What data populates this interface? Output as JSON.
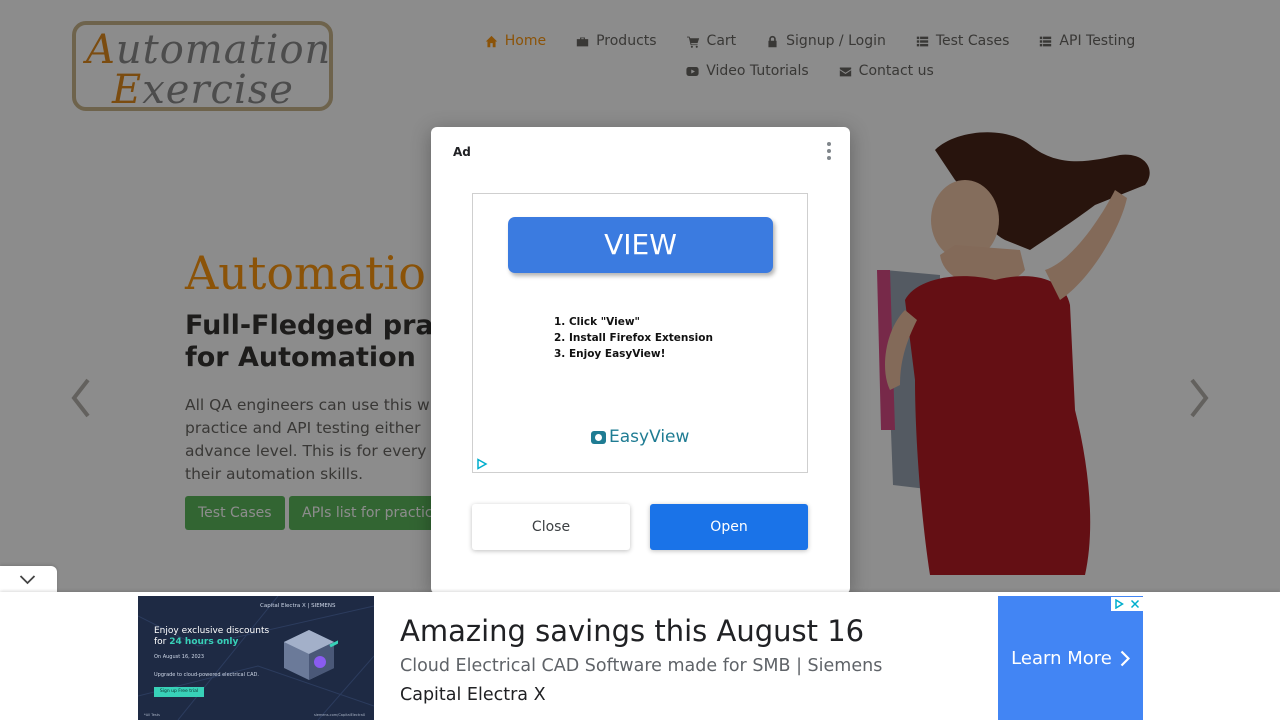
{
  "logo": {
    "line1_cap": "A",
    "line1_rest": "utomation",
    "line2_cap": "E",
    "line2_rest": "xercise"
  },
  "nav": {
    "row1": [
      {
        "label": "Home",
        "icon": "home-icon",
        "active": true
      },
      {
        "label": "Products",
        "icon": "briefcase-icon"
      },
      {
        "label": "Cart",
        "icon": "cart-icon"
      },
      {
        "label": "Signup / Login",
        "icon": "lock-icon"
      },
      {
        "label": "Test Cases",
        "icon": "list-icon"
      },
      {
        "label": "API Testing",
        "icon": "list-icon"
      }
    ],
    "row2": [
      {
        "label": "Video Tutorials",
        "icon": "youtube-icon"
      },
      {
        "label": "Contact us",
        "icon": "envelope-icon"
      }
    ]
  },
  "hero": {
    "title": "Automatio",
    "subtitle_line1": "Full-Fledged pra",
    "subtitle_line2": "for Automation",
    "desc_line1": "All QA engineers can use this w",
    "desc_line2": "practice and API testing either",
    "desc_line3": "advance level. This is for every",
    "desc_line4": "their automation skills.",
    "btn_test_cases": "Test Cases",
    "btn_api": "APIs list for practic"
  },
  "ad_dialog": {
    "label": "Ad",
    "view_button": "VIEW",
    "step1": "1. Click \"View\"",
    "step2": "2. Install Firefox Extension",
    "step3": "3. Enjoy EasyView!",
    "brand": "EasyView",
    "close_label": "Close",
    "open_label": "Open"
  },
  "anchor_ad": {
    "image": {
      "brand": "Capital Electra X | SIEMENS",
      "line1": "Enjoy exclusive discounts",
      "line2_pre": "for ",
      "line2_highlight": "24 hours only",
      "date": "On August 16, 2023",
      "upgrade": "Upgrade to cloud-powered electrical CAD.",
      "cta": "Sign up Free trial",
      "footer_left": "*All Tests",
      "footer_right": "siemens.com/CapitalElectraX"
    },
    "title": "Amazing savings this August 16",
    "subtitle": "Cloud Electrical CAD Software made for SMB | Siemens",
    "advertiser": "Capital Electra X",
    "cta_label": "Learn More"
  },
  "colors": {
    "accent": "#fe980f",
    "green": "#5cb85c",
    "open_blue": "#1a73e8",
    "cta_blue": "#4285f4"
  }
}
